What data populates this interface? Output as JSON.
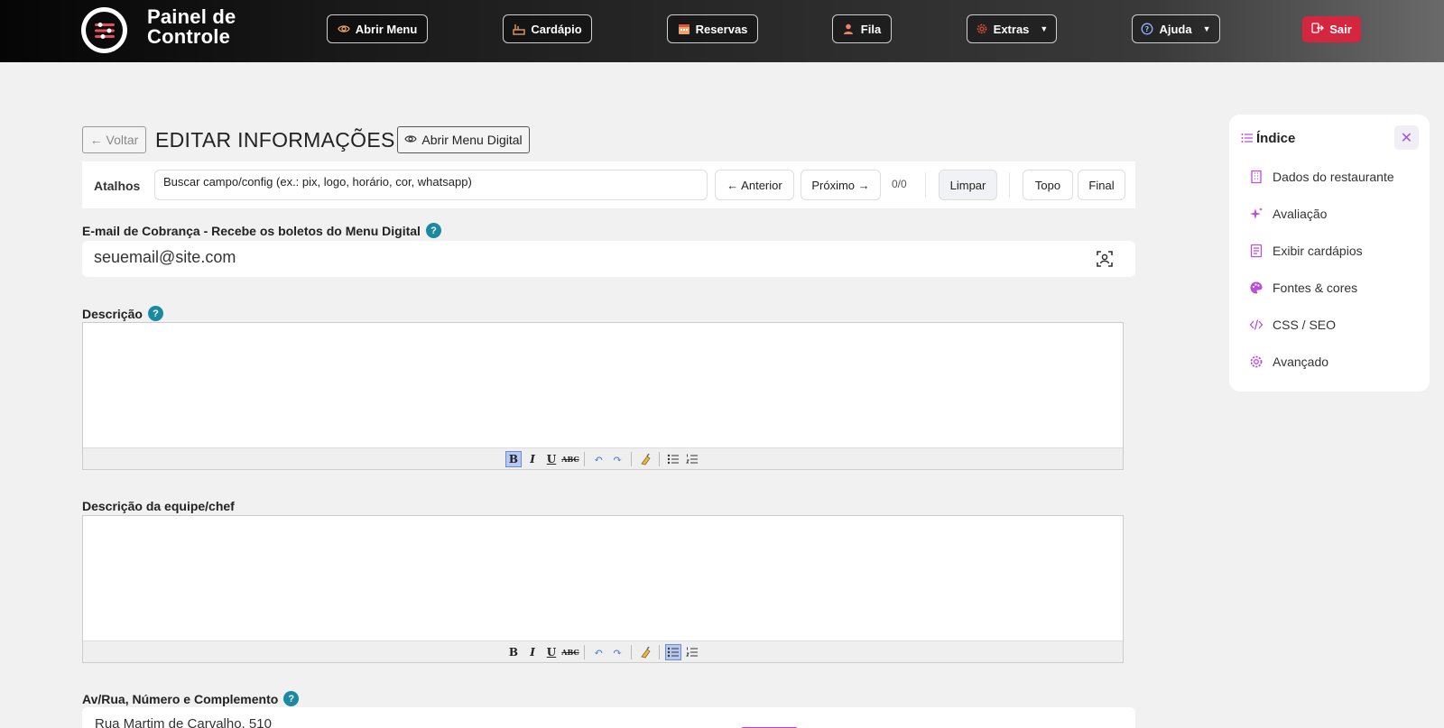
{
  "header": {
    "brand_line1": "Painel de",
    "brand_line2": "Controle",
    "nav": [
      {
        "label": "Abrir Menu",
        "icon": "eye-icon"
      },
      {
        "label": "Cardápio",
        "icon": "food-icon"
      },
      {
        "label": "Reservas",
        "icon": "calendar-icon"
      },
      {
        "label": "Fila",
        "icon": "user-icon"
      },
      {
        "label": "Extras",
        "icon": "gear-icon"
      },
      {
        "label": "Ajuda",
        "icon": "question-icon"
      }
    ],
    "logout_label": "Sair",
    "accent": "#d4263e"
  },
  "page": {
    "back_label": "← Voltar",
    "title": "EDITAR INFORMAÇÕES",
    "open_digital_label": "Abrir Menu Digital"
  },
  "shortcuts": {
    "label": "Atalhos",
    "search_placeholder": "Buscar campo/config (ex.: pix, logo, horário, cor, whatsapp)",
    "prev_label": "← Anterior",
    "next_label": "Próximo →",
    "count": "0/0",
    "clear_label": "Limpar",
    "top_label": "Topo",
    "end_label": "Final"
  },
  "fields": {
    "email_label": "E-mail de Cobrança - Recebe os boletos do Menu Digital",
    "email_value": "seuemail@site.com",
    "description_label": "Descrição",
    "team_label": "Descrição da equipe/chef",
    "address_label": "Av/Rua, Número e Complemento",
    "address_value": "Rua Martim de Carvalho, 510"
  },
  "index": {
    "title": "Índice",
    "items": [
      {
        "label": "Dados do restaurante",
        "icon": "building-icon"
      },
      {
        "label": "Avaliação",
        "icon": "sparkle-icon"
      },
      {
        "label": "Exibir cardápios",
        "icon": "document-icon"
      },
      {
        "label": "Fontes & cores",
        "icon": "palette-icon"
      },
      {
        "label": "CSS / SEO",
        "icon": "code-icon"
      },
      {
        "label": "Avançado",
        "icon": "gear-icon"
      }
    ],
    "accent": "#b94fd6"
  },
  "help_mark": "?"
}
